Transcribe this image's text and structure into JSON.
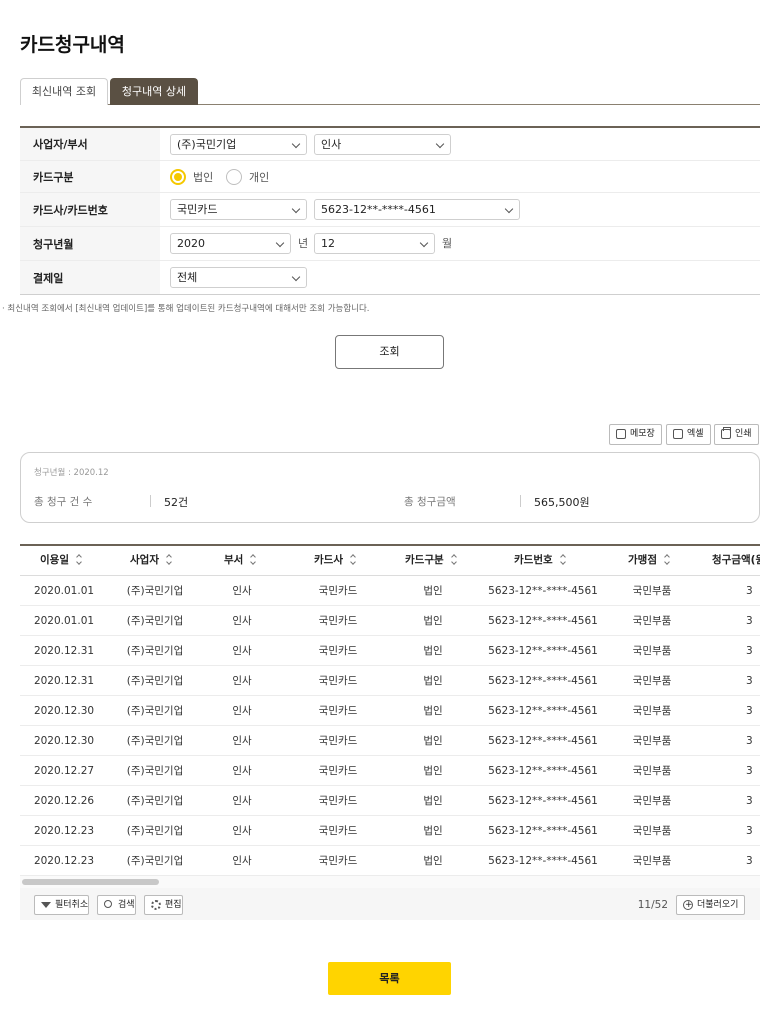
{
  "page_title": "카드청구내역",
  "tabs": [
    {
      "label": "최신내역 조회",
      "active": false
    },
    {
      "label": "청구내역 상세",
      "active": true
    }
  ],
  "form": {
    "row1_label": "사업자/부서",
    "company_value": "(주)국민기업",
    "dept_value": "인사",
    "row2_label": "카드구분",
    "radio_corporate": "법인",
    "radio_personal": "개인",
    "row3_label": "카드사/카드번호",
    "card_company_value": "국민카드",
    "card_number_value": "5623-12**-****-4561",
    "row4_label": "청구년월",
    "year_value": "2020",
    "year_unit": "년",
    "month_value": "12",
    "month_unit": "월",
    "row5_label": "결제일",
    "payday_value": "전체"
  },
  "notice": "· 최신내역 조회에서 [최신내역 업데이트]를 통해 업데이트된 카드청구내역에 대해서만 조회 가능합니다.",
  "search_button": "조회",
  "toolbar": {
    "memo_label": "메모장",
    "excel_label": "엑셀",
    "print_label": "인쇄"
  },
  "summary": {
    "period": "청구년월 : 2020.12",
    "count_label": "총 청구 건 수",
    "count_value": "52건",
    "amount_label": "총 청구금액",
    "amount_value": "565,500원"
  },
  "grid": {
    "headers": [
      "이용일",
      "사업자",
      "부서",
      "카드사",
      "카드구분",
      "카드번호",
      "가맹점",
      "청구금액(원"
    ],
    "rows": [
      [
        "2020.01.01",
        "(주)국민기업",
        "인사",
        "국민카드",
        "법인",
        "5623-12**-****-4561",
        "국민부품",
        "3"
      ],
      [
        "2020.01.01",
        "(주)국민기업",
        "인사",
        "국민카드",
        "법인",
        "5623-12**-****-4561",
        "국민부품",
        "3"
      ],
      [
        "2020.12.31",
        "(주)국민기업",
        "인사",
        "국민카드",
        "법인",
        "5623-12**-****-4561",
        "국민부품",
        "3"
      ],
      [
        "2020.12.31",
        "(주)국민기업",
        "인사",
        "국민카드",
        "법인",
        "5623-12**-****-4561",
        "국민부품",
        "3"
      ],
      [
        "2020.12.30",
        "(주)국민기업",
        "인사",
        "국민카드",
        "법인",
        "5623-12**-****-4561",
        "국민부품",
        "3"
      ],
      [
        "2020.12.30",
        "(주)국민기업",
        "인사",
        "국민카드",
        "법인",
        "5623-12**-****-4561",
        "국민부품",
        "3"
      ],
      [
        "2020.12.27",
        "(주)국민기업",
        "인사",
        "국민카드",
        "법인",
        "5623-12**-****-4561",
        "국민부품",
        "3"
      ],
      [
        "2020.12.26",
        "(주)국민기업",
        "인사",
        "국민카드",
        "법인",
        "5623-12**-****-4561",
        "국민부품",
        "3"
      ],
      [
        "2020.12.23",
        "(주)국민기업",
        "인사",
        "국민카드",
        "법인",
        "5623-12**-****-4561",
        "국민부품",
        "3"
      ],
      [
        "2020.12.23",
        "(주)국민기업",
        "인사",
        "국민카드",
        "법인",
        "5623-12**-****-4561",
        "국민부품",
        "3"
      ]
    ],
    "filter_reset_label": "필터취소",
    "search_label": "검색",
    "edit_label": "편집",
    "page_info": "11/52",
    "load_more_label": "더불러오기"
  },
  "list_button": "목록",
  "colors": {
    "accent": "#ffd400",
    "tab_active": "#5a5043",
    "radio_on": "#f5c800"
  }
}
